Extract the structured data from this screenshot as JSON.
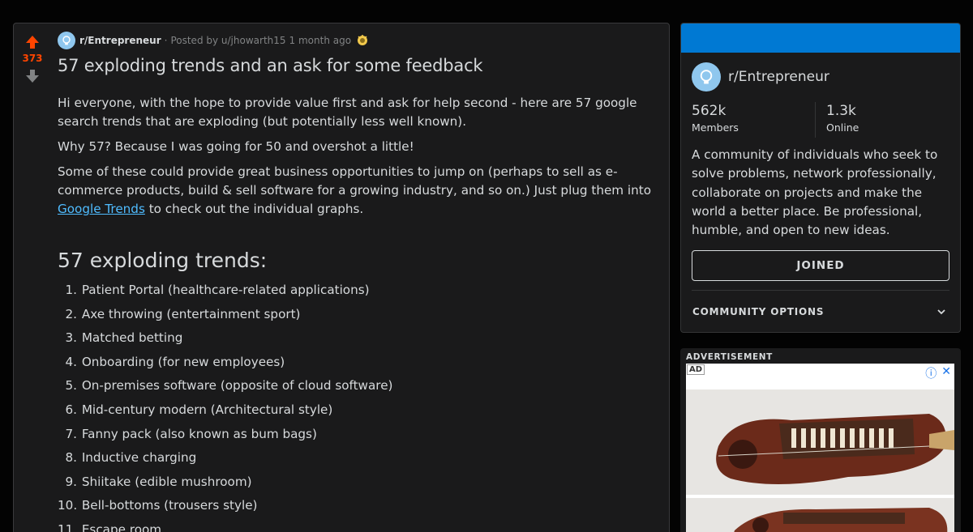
{
  "post": {
    "votes": "373",
    "subreddit": "r/Entrepreneur",
    "posted_by": "Posted by u/jhowarth15",
    "time": "1 month ago",
    "title": "57 exploding trends and an ask for some feedback",
    "para1": "Hi everyone, with the hope to provide value first and ask for help second - here are 57 google search trends that are exploding (but potentially less well known).",
    "para2": "Why 57? Because I was going for 50 and overshot a little!",
    "para3_before": "Some of these could provide great business opportunities to jump on (perhaps to sell as e-commerce products, build & sell software for a growing industry, and so on.) Just plug them into ",
    "para3_link": "Google Trends",
    "para3_after": " to check out the individual graphs.",
    "list_heading": "57 exploding trends:",
    "trends": [
      {
        "num": "1.",
        "text": "Patient Portal (healthcare-related applications)"
      },
      {
        "num": "2.",
        "text": "Axe throwing (entertainment sport)"
      },
      {
        "num": "3.",
        "text": "Matched betting"
      },
      {
        "num": "4.",
        "text": "Onboarding (for new employees)"
      },
      {
        "num": "5.",
        "text": "On-premises software (opposite of cloud software)"
      },
      {
        "num": "6.",
        "text": "Mid-century modern (Architectural style)"
      },
      {
        "num": "7.",
        "text": "Fanny pack (also known as bum bags)"
      },
      {
        "num": "8.",
        "text": "Inductive charging"
      },
      {
        "num": "9.",
        "text": "Shiitake (edible mushroom)"
      },
      {
        "num": "10.",
        "text": "Bell-bottoms (trousers style)"
      },
      {
        "num": "11.",
        "text": "Escape room"
      }
    ]
  },
  "sidebar": {
    "community_name": "r/Entrepreneur",
    "members_value": "562k",
    "members_label": "Members",
    "online_value": "1.3k",
    "online_label": "Online",
    "description": "A community of individuals who seek to solve problems, network professionally, collaborate on projects and make the world a better place. Be professional, humble, and open to new ideas.",
    "joined_label": "JOINED",
    "options_label": "COMMUNITY OPTIONS",
    "ad_label": "ADVERTISEMENT",
    "ad_badge": "AD"
  },
  "colors": {
    "upvote": "#ff4500",
    "banner": "#0079d3",
    "link": "#4fbcff",
    "background": "#030303",
    "card": "#1a1a1b"
  }
}
